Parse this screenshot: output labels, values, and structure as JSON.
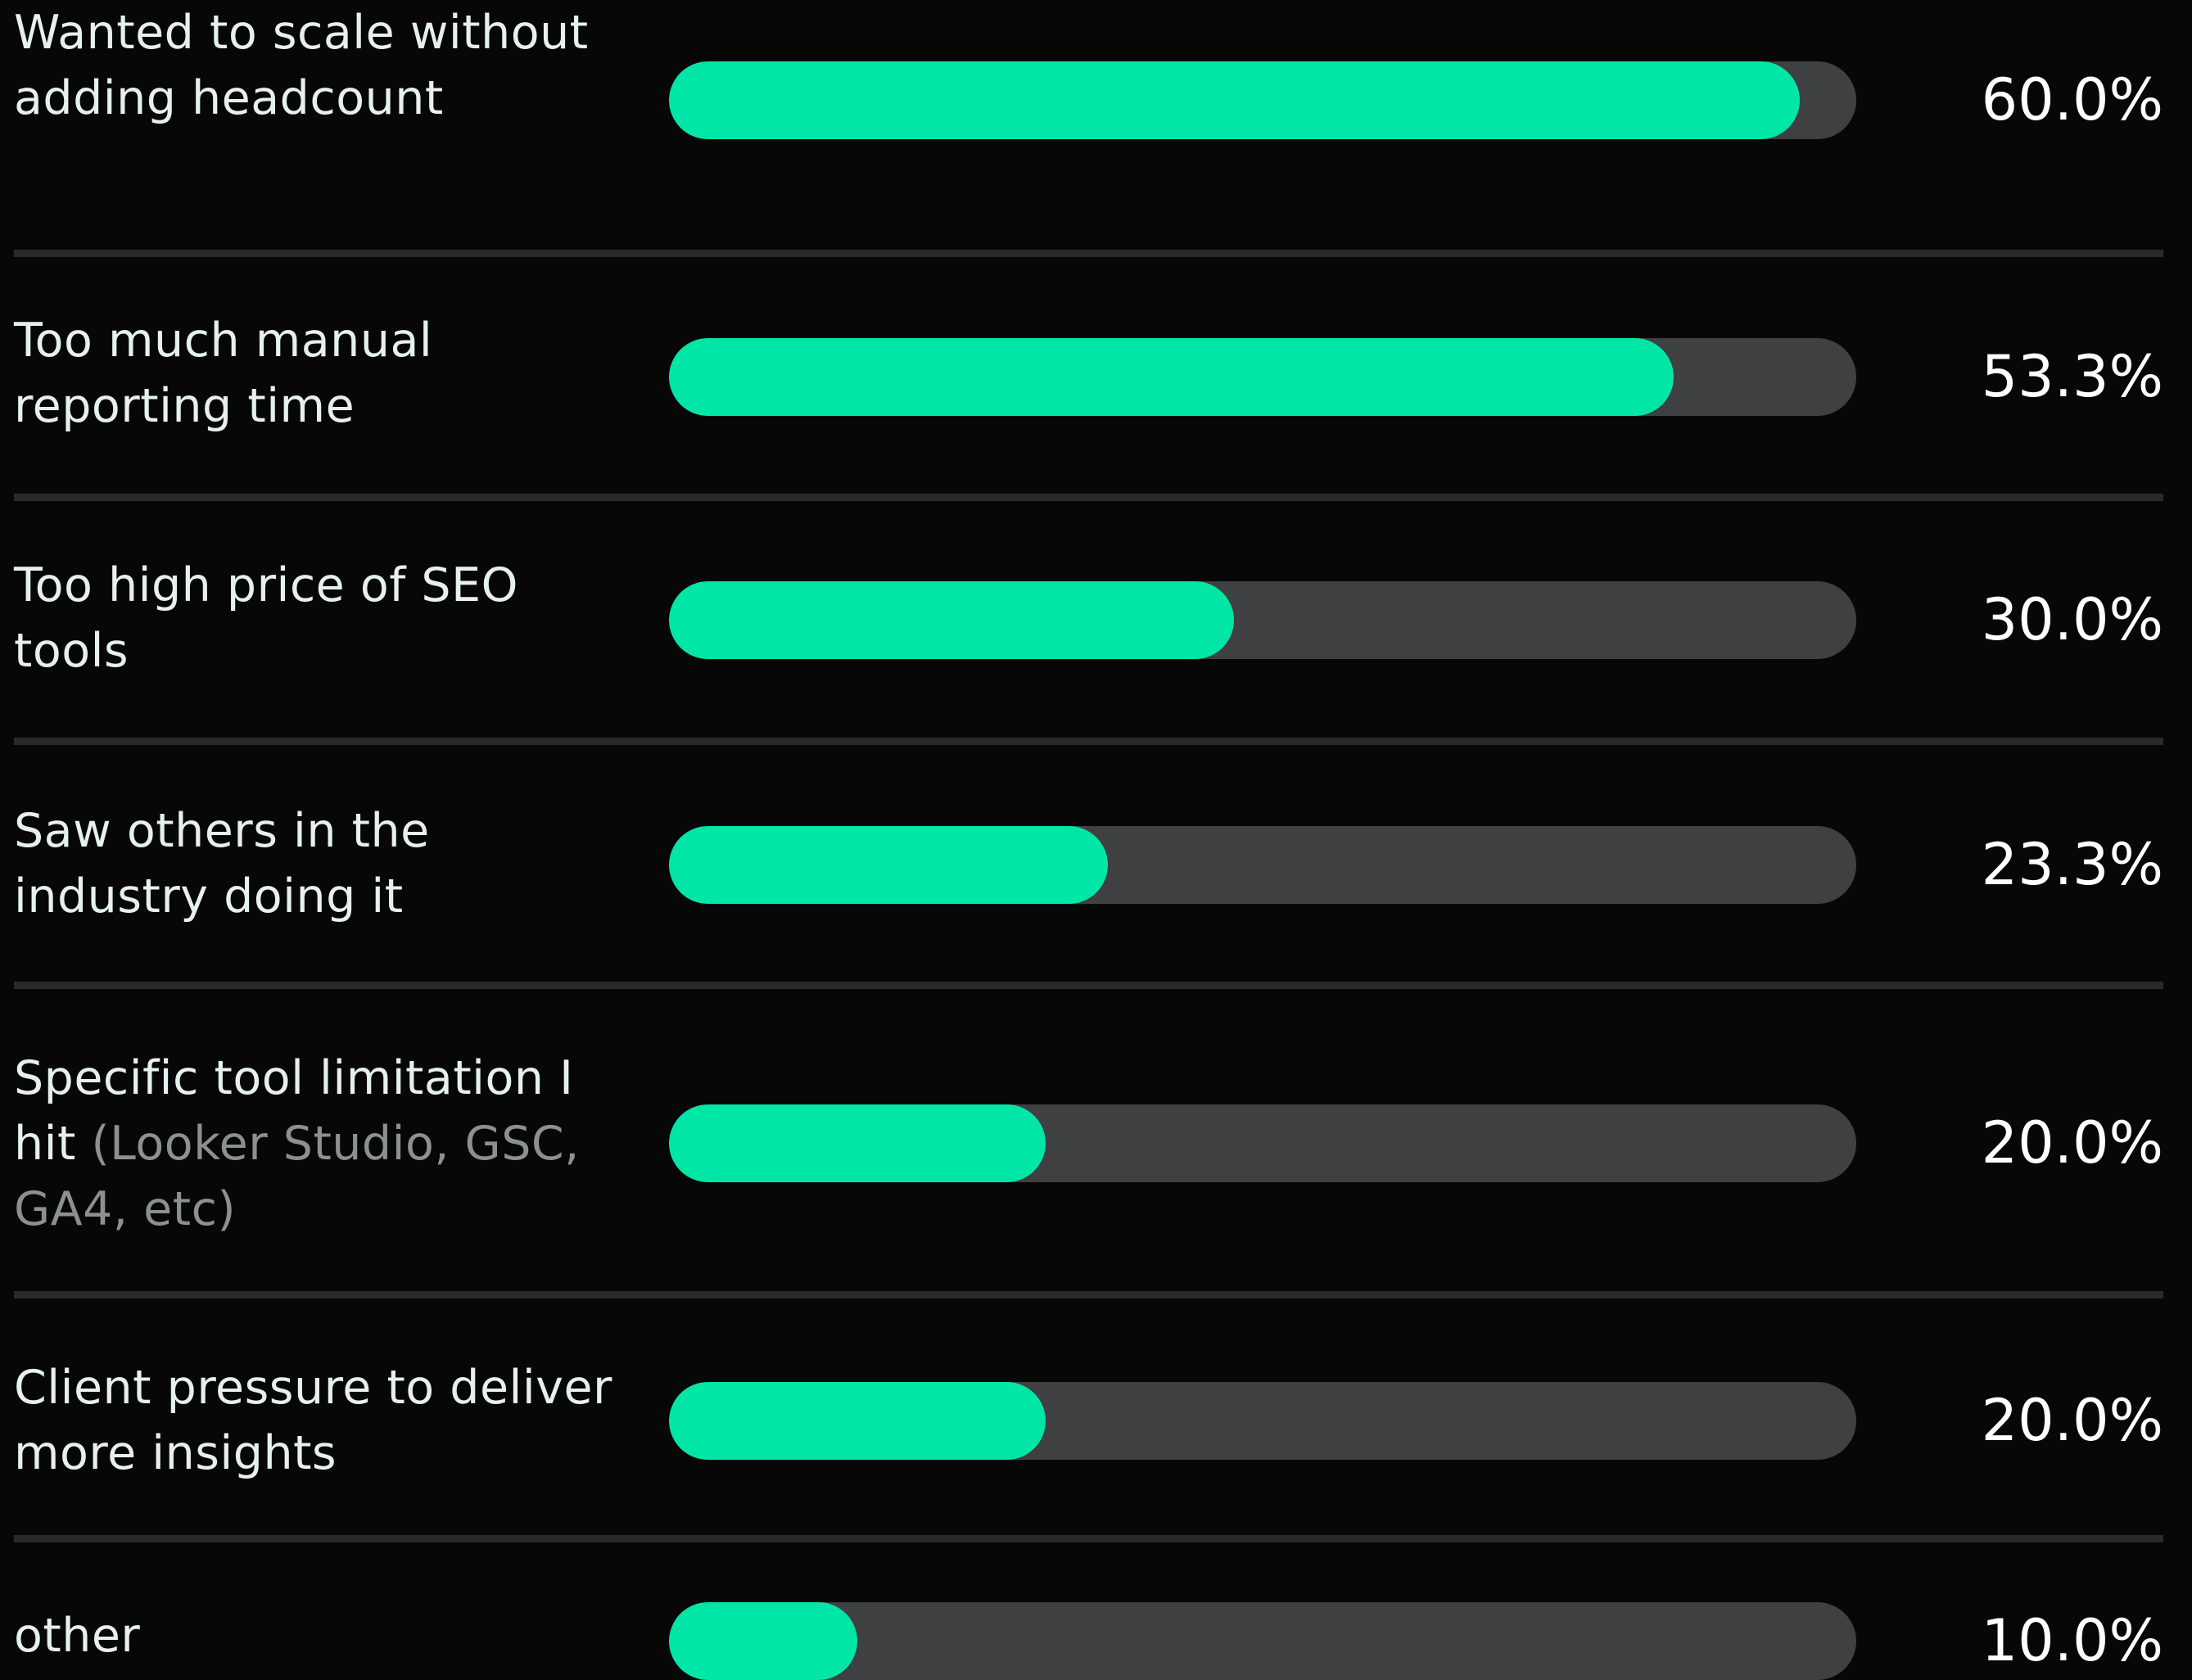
{
  "chart_data": {
    "type": "bar",
    "orientation": "horizontal",
    "xlim": [
      0,
      63
    ],
    "categories": [
      "Wanted to scale without adding headcount",
      "Too much manual reporting time",
      "Too high price of SEO tools",
      "Saw others in the industry doing it",
      "Specific tool limitation I hit (Looker Studio, GSC, GA4, etc)",
      "Client pressure to deliver more insights",
      "other"
    ],
    "values": [
      60.0,
      53.3,
      30.0,
      23.3,
      20.0,
      20.0,
      10.0
    ],
    "value_labels": [
      "60.0%",
      "53.3%",
      "30.0%",
      "23.3%",
      "20.0%",
      "20.0%",
      "10.0%"
    ],
    "label_parts": [
      {
        "main": "Wanted to scale without adding headcount",
        "muted": ""
      },
      {
        "main": "Too much manual reporting time",
        "muted": ""
      },
      {
        "main": "Too high price of SEO tools",
        "muted": ""
      },
      {
        "main": "Saw others in the industry doing it",
        "muted": ""
      },
      {
        "main": "Specific tool limitation I hit",
        "muted": "(Looker Studio, GSC, GA4, etc)"
      },
      {
        "main": "Client pressure to deliver more insights",
        "muted": ""
      },
      {
        "main": "other",
        "muted": ""
      }
    ],
    "colors": {
      "fill": "#00e6a7",
      "track": "#3f4042",
      "background": "#070707",
      "label": "#e6f0ef",
      "muted_label": "#8b9190",
      "value": "#ffffff",
      "divider": "#2a2a2b"
    }
  }
}
